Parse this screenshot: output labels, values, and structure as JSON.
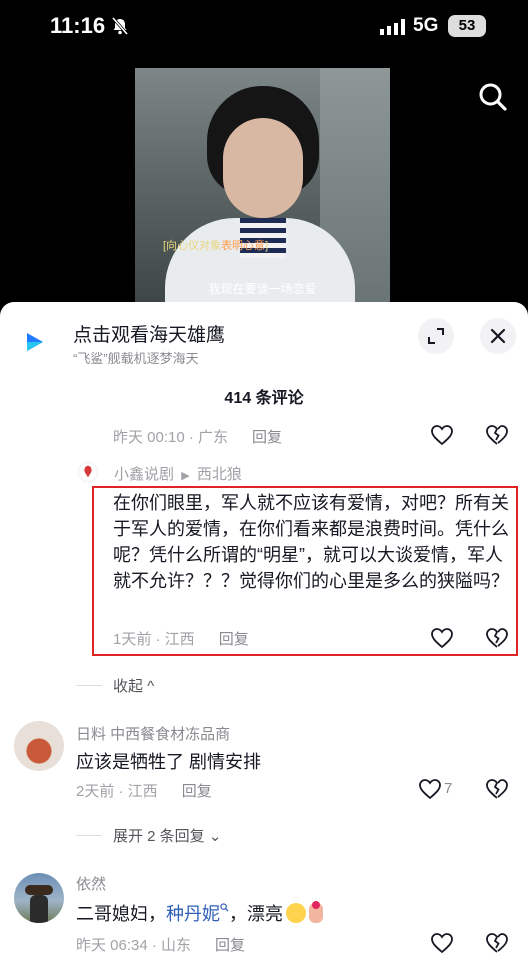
{
  "status_bar": {
    "time": "11:16",
    "network": "5G",
    "battery": "53"
  },
  "video": {
    "subtitle_prefix": "[向心仪对象",
    "subtitle_highlight": "表明心意",
    "subtitle_suffix": "]",
    "caption": "我现在要谈一场恋爱"
  },
  "promo": {
    "title": "点击观看海天雄鹰",
    "subtitle": "“飞鲨”舰载机逐梦海天"
  },
  "comments_count": "414 条评论",
  "top_meta": {
    "time": "昨天 00:10 · 广东",
    "reply": "回复"
  },
  "reply": {
    "author": "小鑫说剧",
    "reply_to_arrow": "▶",
    "target": "西北狼",
    "text": "在你们眼里，军人就不应该有爱情，对吧？所有关于军人的爱情，在你们看来都是浪费时间。凭什么呢？凭什么所谓的“明星”，就可以大谈爱情，军人就不允许？？？觉得你们的心里是多么的狭隘吗？",
    "time": "1天前 · 江西",
    "reply_label": "回复"
  },
  "collapse_label": "收起 ^",
  "comments": [
    {
      "user": "日料 中西餐食材冻品商",
      "text": "应该是牺牲了 剧情安排",
      "time": "2天前 · 江西",
      "reply_label": "回复",
      "likes": "7"
    },
    {
      "user": "依然",
      "text_prefix": "二哥媳妇，",
      "text_link": "种丹妮",
      "text_suffix": "，漂亮",
      "time": "昨天 06:34 · 山东",
      "reply_label": "回复"
    }
  ],
  "expand_label": "展开 2 条回复 ⌄",
  "colors": {
    "highlight_border": "#e02424",
    "link": "#2f5fb8"
  }
}
